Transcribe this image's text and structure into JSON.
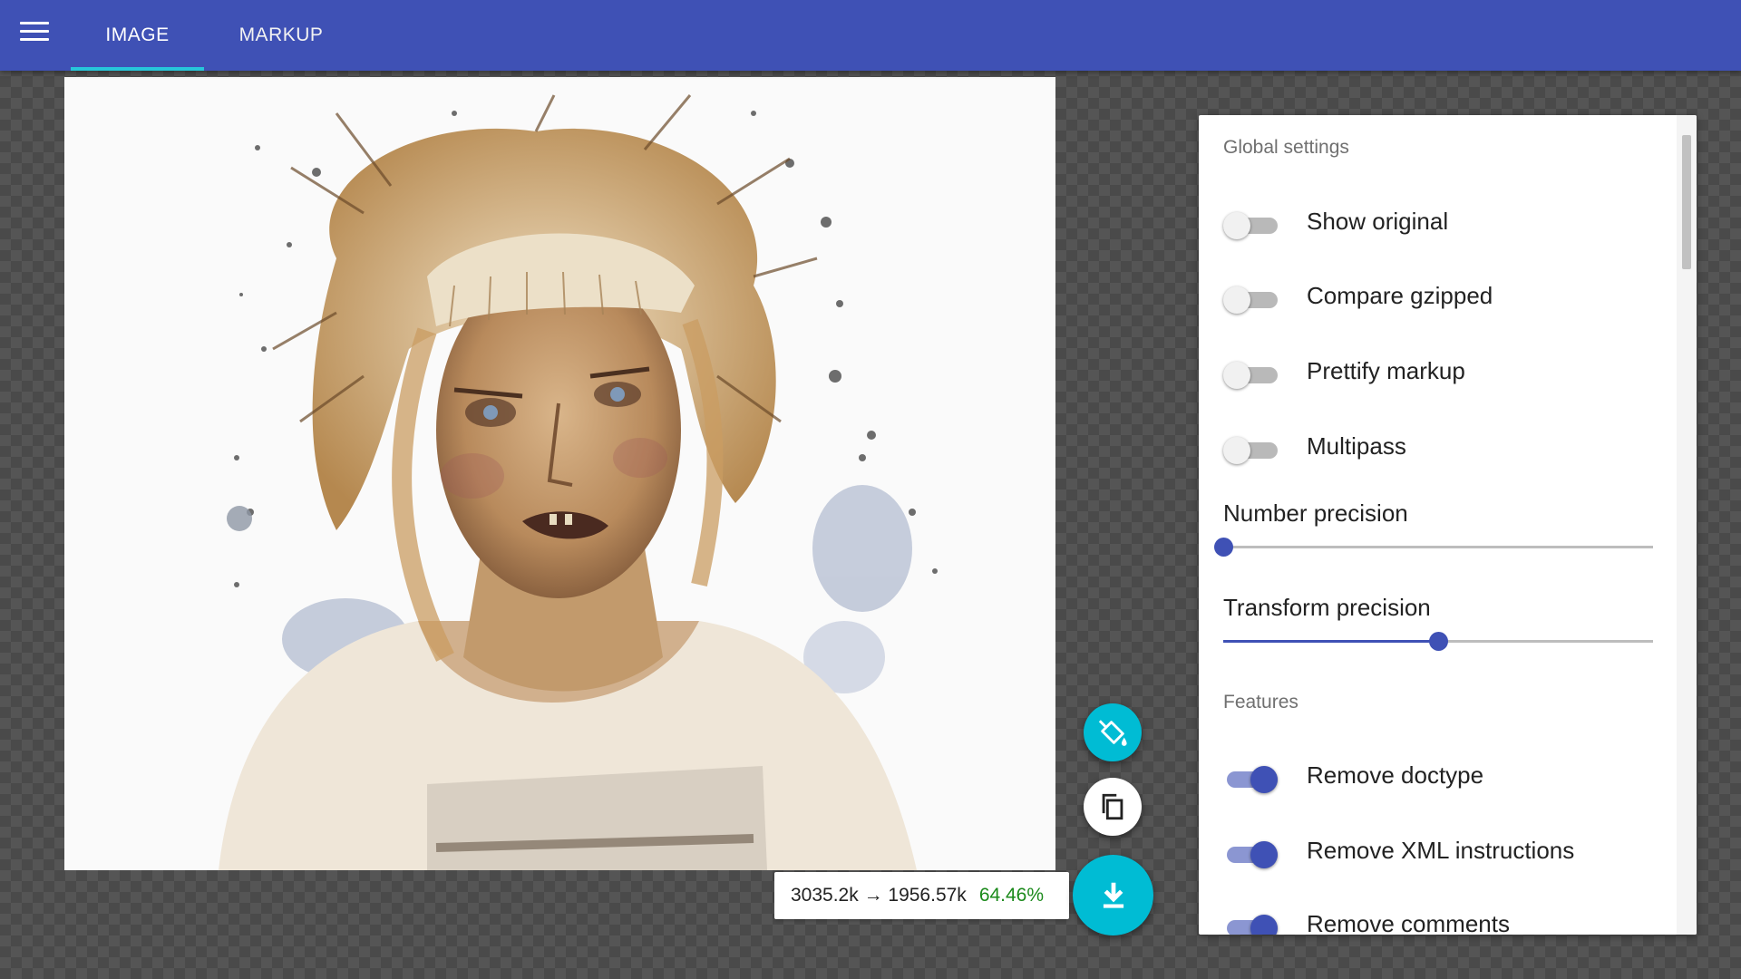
{
  "appbar": {
    "menu_icon": "hamburger-menu-icon",
    "tabs": [
      {
        "label": "IMAGE",
        "active": true
      },
      {
        "label": "MARKUP",
        "active": false
      }
    ],
    "accent": "#26c6da",
    "color": "#3f51b5"
  },
  "stats": {
    "sizes": "3035.2k → 1956.57k",
    "percent": "64.46%"
  },
  "fabs": {
    "background_icon": "paint-bucket-icon",
    "copy_icon": "copy-icon",
    "download_icon": "download-icon"
  },
  "settings": {
    "global_title": "Global settings",
    "global_toggles": [
      {
        "label": "Show original",
        "on": false
      },
      {
        "label": "Compare gzipped",
        "on": false
      },
      {
        "label": "Prettify markup",
        "on": false
      },
      {
        "label": "Multipass",
        "on": false
      }
    ],
    "number_precision": {
      "label": "Number precision",
      "value_fraction": 0.0
    },
    "transform_precision": {
      "label": "Transform precision",
      "value_fraction": 0.5
    },
    "features_title": "Features",
    "feature_toggles": [
      {
        "label": "Remove doctype",
        "on": true
      },
      {
        "label": "Remove XML instructions",
        "on": true
      },
      {
        "label": "Remove comments",
        "on": true
      }
    ]
  }
}
